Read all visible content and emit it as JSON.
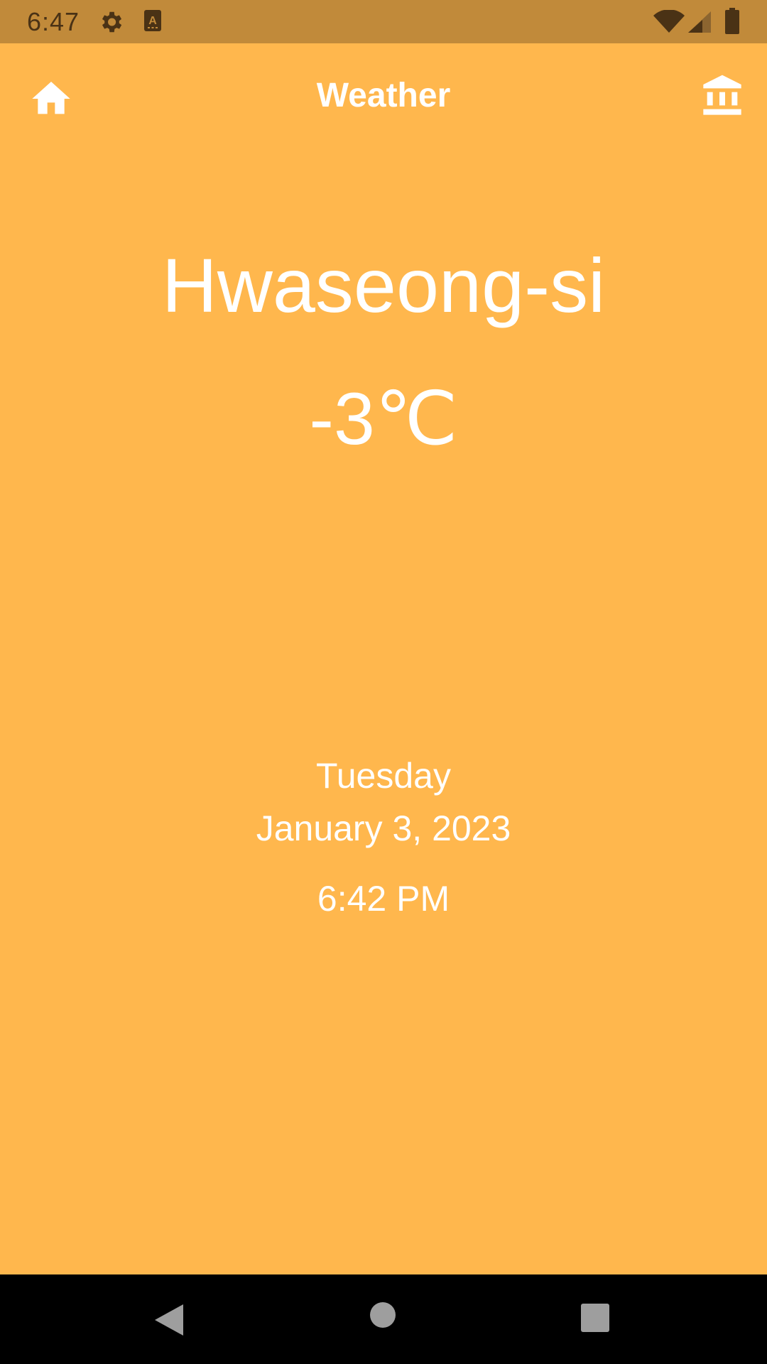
{
  "status_bar": {
    "time": "6:47",
    "icons": [
      "gear-icon",
      "a-keyboard-icon",
      "wifi-icon",
      "signal-icon",
      "battery-icon"
    ],
    "background": "#C18A3A"
  },
  "app_bar": {
    "title": "Weather",
    "left_icon": "home-icon",
    "right_icon": "bank-icon"
  },
  "weather": {
    "city": "Hwaseong-si",
    "temperature": "-3℃"
  },
  "datetime": {
    "day": "Tuesday",
    "date": "January 3, 2023",
    "time": "6:42 PM"
  },
  "nav_bar": {
    "icons": [
      "back-icon",
      "home-circle-icon",
      "recents-icon"
    ]
  },
  "colors": {
    "background": "#FFB74D",
    "text": "#FFFFFF"
  }
}
